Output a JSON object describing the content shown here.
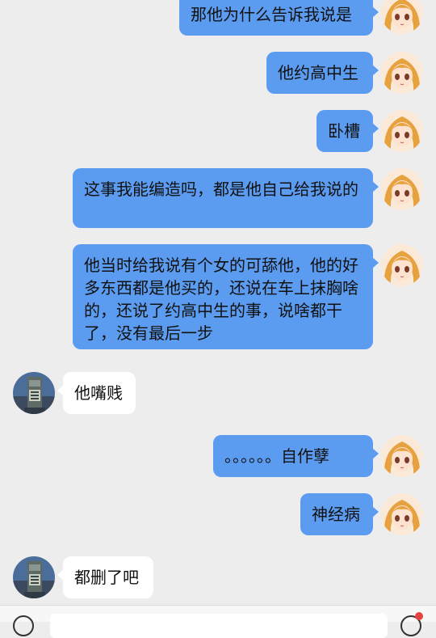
{
  "messages": [
    {
      "side": "right",
      "text": "那他为什么告诉我说是"
    },
    {
      "side": "right",
      "text": "他约高中生"
    },
    {
      "side": "right",
      "text": "卧槽"
    },
    {
      "side": "right",
      "text": "这事我能编造吗，都是他自己给我说的"
    },
    {
      "side": "right",
      "text": "他当时给我说有个女的可舔他，他的好多东西都是他买的，还说在车上抹胸啥的，还说了约高中生的事，说啥都干了，没有最后一步"
    },
    {
      "side": "left",
      "text": "他嘴贱"
    },
    {
      "side": "right",
      "text": "。。。。。。自作孽"
    },
    {
      "side": "right",
      "text": "神经病"
    },
    {
      "side": "left",
      "text": "都删了吧"
    }
  ],
  "icons": {
    "my_avatar": "anime-girl-avatar",
    "their_avatar": "statue-photo-avatar",
    "voice": "voice-icon",
    "emoji": "emoji-icon"
  },
  "colors": {
    "background": "#ededed",
    "my_bubble": "#5b9cf0",
    "their_bubble": "#ffffff",
    "notification_dot": "#e64340"
  }
}
